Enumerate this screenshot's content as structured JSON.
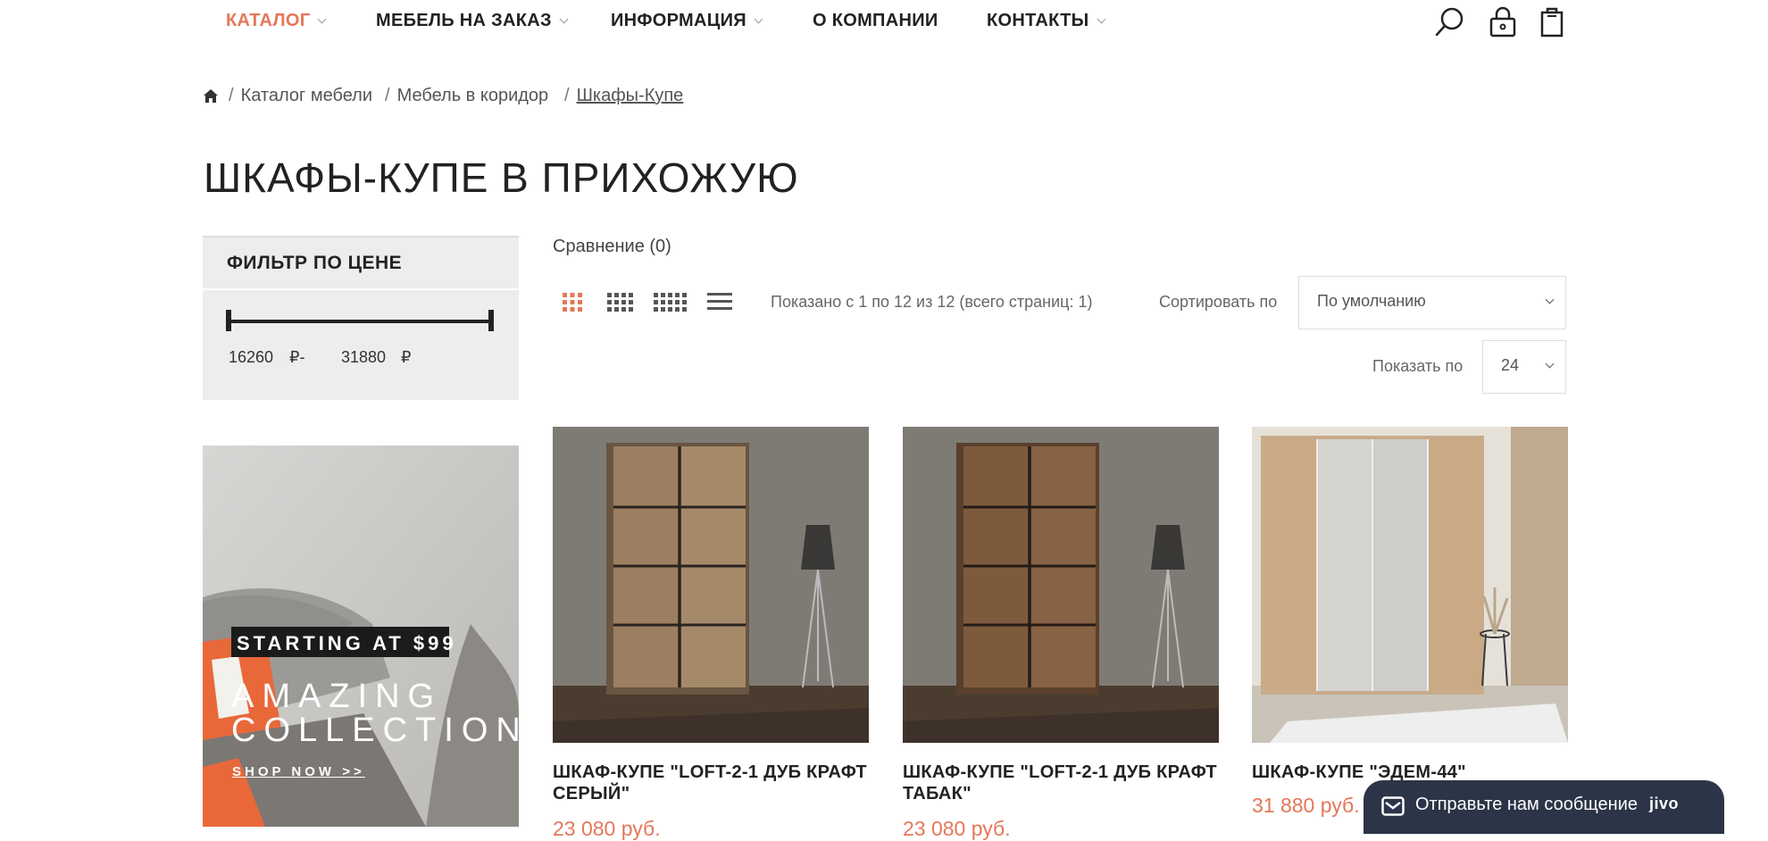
{
  "nav": {
    "items": [
      {
        "label": "КАТАЛОГ",
        "active": true,
        "dropdown": true
      },
      {
        "label": "МЕБЕЛЬ НА ЗАКАЗ",
        "dropdown": true
      },
      {
        "label": "ИНФОРМАЦИЯ",
        "dropdown": true
      },
      {
        "label": "О КОМПАНИИ",
        "dropdown": false
      },
      {
        "label": "КОНТАКТЫ",
        "dropdown": true
      }
    ],
    "icons": [
      "search-icon",
      "lock-icon",
      "cart-icon"
    ],
    "accent_color": "#e4775a"
  },
  "breadcrumb": {
    "home_icon": "home-icon",
    "items": [
      "Каталог мебели",
      "Мебель в коридор",
      "Шкафы-Купе"
    ]
  },
  "page": {
    "title": "ШКАФЫ-КУПЕ В ПРИХОЖУЮ"
  },
  "filter": {
    "title": "ФИЛЬТР ПО ЦЕНЕ",
    "min": "16260",
    "min_currency": "₽-",
    "max": "31880",
    "max_currency": "₽"
  },
  "banner": {
    "tag": "STARTING AT $99",
    "title_line1": "AMAZING",
    "title_line2": "COLLECTION",
    "cta": "SHOP NOW >>"
  },
  "toolbar": {
    "compare": "Сравнение (0)",
    "view_icons": [
      "grid-3-icon",
      "grid-4-icon",
      "grid-5-icon",
      "list-icon"
    ],
    "results": "Показано с 1 по 12 из 12 (всего страниц: 1)",
    "sort_label": "Сортировать по",
    "sort_value": "По умолчанию",
    "limit_label": "Показать по",
    "limit_value": "24"
  },
  "products": [
    {
      "title": "ШКАФ-КУПЕ \"LOFT-2-1 ДУБ КРАФТ СЕРЫЙ\"",
      "price": "23 080 руб."
    },
    {
      "title": "ШКАФ-КУПЕ \"LOFT-2-1 ДУБ КРАФТ ТАБАК\"",
      "price": "23 080 руб."
    },
    {
      "title": "ШКАФ-КУПЕ \"ЭДЕМ-44\"",
      "price": "31 880 руб."
    }
  ],
  "chat": {
    "text": "Отправьте нам сообщение",
    "brand": "jivo"
  }
}
